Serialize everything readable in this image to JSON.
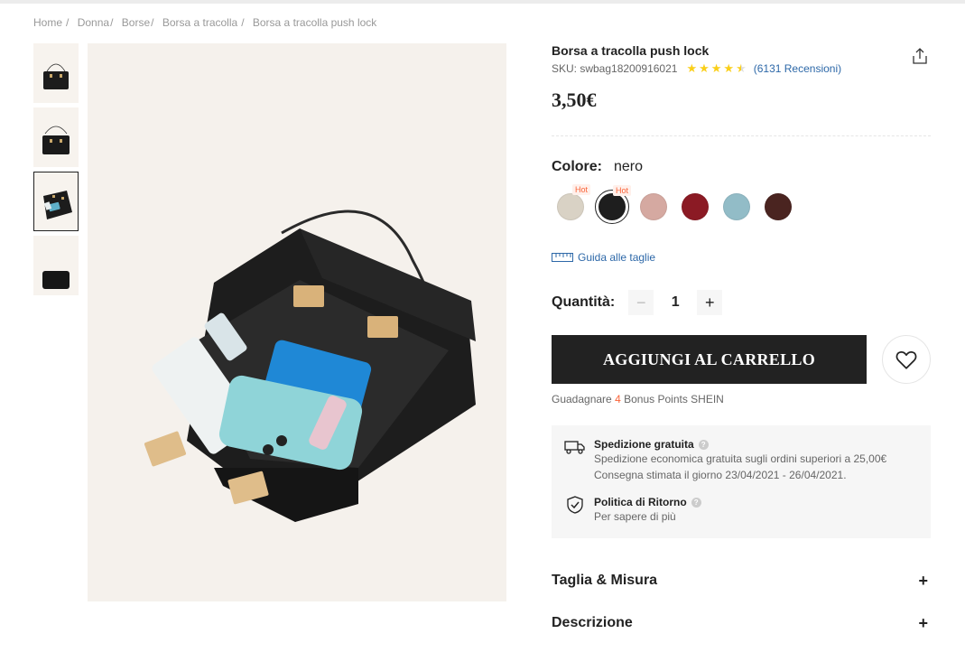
{
  "breadcrumb": [
    {
      "label": "Home"
    },
    {
      "label": "Donna"
    },
    {
      "label": "Borse"
    },
    {
      "label": "Borsa a tracolla"
    },
    {
      "label": "Borsa a tracolla push lock"
    }
  ],
  "product": {
    "title": "Borsa a tracolla push lock",
    "sku_label": "SKU: swbag18200916021",
    "rating": 4.5,
    "reviews_label": "(6131 Recensioni)",
    "price": "3,50€"
  },
  "color": {
    "label": "Colore:",
    "selected": "nero",
    "swatches": [
      {
        "name": "beige",
        "hex": "#d9d2c5",
        "hot": "Hot"
      },
      {
        "name": "nero",
        "hex": "#1e1e1e",
        "hot": "Hot",
        "selected": true
      },
      {
        "name": "rosa",
        "hex": "#d5a9a1"
      },
      {
        "name": "bordeaux",
        "hex": "#8b1a24"
      },
      {
        "name": "azzurro",
        "hex": "#92bcc7"
      },
      {
        "name": "marrone",
        "hex": "#4a2420"
      }
    ]
  },
  "size_guide_label": "Guida alle taglie",
  "quantity": {
    "label": "Quantità:",
    "value": "1",
    "minus": "−",
    "plus": "+"
  },
  "add_to_cart_label": "AGGIUNGI AL CARRELLO",
  "points": {
    "prefix": "Guadagnare",
    "value": "4",
    "suffix": "Bonus Points SHEIN"
  },
  "shipping": {
    "title": "Spedizione gratuita",
    "line1": "Spedizione economica gratuita sugli ordini superiori a 25,00€",
    "line2": "Consegna stimata il giorno 23/04/2021 - 26/04/2021."
  },
  "returns": {
    "title": "Politica di Ritorno",
    "text": "Per sapere di più"
  },
  "help_mark": "?",
  "accordion": [
    {
      "title": "Taglia & Misura",
      "icon": "+"
    },
    {
      "title": "Descrizione",
      "icon": "+"
    }
  ],
  "colors": {
    "accent_link": "#2d68a8",
    "star": "#facf19",
    "hot": "#fa6338",
    "button_bg": "#222222"
  }
}
